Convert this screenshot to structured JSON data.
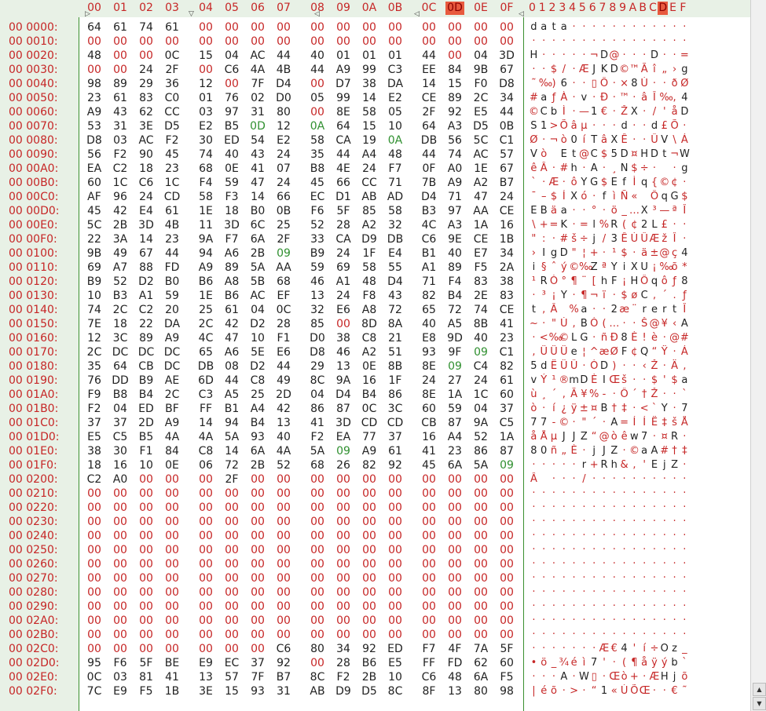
{
  "header": {
    "offsets": [
      "00",
      "01",
      "02",
      "03",
      "04",
      "05",
      "06",
      "07",
      "08",
      "09",
      "0A",
      "0B",
      "0C",
      "0D",
      "0E",
      "0F"
    ],
    "ascii_header": "0123456789ABCDEF",
    "selected_col": 13
  },
  "rows": [
    {
      "addr": "00 0000:",
      "bytes": [
        "64",
        "61",
        "74",
        "61",
        "00",
        "00",
        "00",
        "00",
        "00",
        "00",
        "00",
        "00",
        "00",
        "00",
        "00",
        "00"
      ],
      "ascii": "data············"
    },
    {
      "addr": "00 0010:",
      "bytes": [
        "00",
        "00",
        "00",
        "00",
        "00",
        "00",
        "00",
        "00",
        "00",
        "00",
        "00",
        "00",
        "00",
        "00",
        "00",
        "00"
      ],
      "ascii": "················"
    },
    {
      "addr": "00 0020:",
      "bytes": [
        "48",
        "00",
        "00",
        "0C",
        "15",
        "04",
        "AC",
        "44",
        "40",
        "01",
        "01",
        "01",
        "44",
        "00",
        "04",
        "3D"
      ],
      "ascii": "H·····¬D@···D··="
    },
    {
      "addr": "00 0030:",
      "bytes": [
        "00",
        "00",
        "24",
        "2F",
        "00",
        "C6",
        "4A",
        "4B",
        "44",
        "A9",
        "99",
        "C3",
        "EE",
        "84",
        "9B",
        "67"
      ],
      "ascii": "··$/·ÆJKD©™Ãî„›g"
    },
    {
      "addr": "00 0040:",
      "bytes": [
        "98",
        "89",
        "29",
        "36",
        "12",
        "00",
        "7F",
        "D4",
        "00",
        "D7",
        "38",
        "DA",
        "14",
        "15",
        "F0",
        "D8"
      ],
      "ascii": "˜‰)6··▯Ô·×8Ú··ðØ"
    },
    {
      "addr": "00 0050:",
      "bytes": [
        "23",
        "61",
        "83",
        "C0",
        "01",
        "76",
        "02",
        "D0",
        "05",
        "99",
        "14",
        "E2",
        "CE",
        "89",
        "2C",
        "34"
      ],
      "ascii": "#aƒÀ·v·Ð·™·âÎ‰,4"
    },
    {
      "addr": "00 0060:",
      "bytes": [
        "A9",
        "43",
        "62",
        "CC",
        "03",
        "97",
        "31",
        "80",
        "00",
        "8E",
        "58",
        "05",
        "2F",
        "92",
        "E5",
        "44"
      ],
      "ascii": "©CbÌ·—1€·ŽX·/'åD"
    },
    {
      "addr": "00 0070:",
      "bytes": [
        "53",
        "31",
        "3E",
        "D5",
        "E2",
        "B5",
        "0D",
        "12",
        "0A",
        "64",
        "15",
        "10",
        "64",
        "A3",
        "D5",
        "0B"
      ],
      "ascii": "S1>Õâµ···d··d£Õ·"
    },
    {
      "addr": "00 0080:",
      "bytes": [
        "D8",
        "03",
        "AC",
        "F2",
        "30",
        "ED",
        "54",
        "E2",
        "58",
        "CA",
        "19",
        "0A",
        "DB",
        "56",
        "5C",
        "C1"
      ],
      "ascii": "Ø·¬ò0íTâXÊ··ÛV\\Á"
    },
    {
      "addr": "00 0090:",
      "bytes": [
        "56",
        "F2",
        "90",
        "45",
        "74",
        "40",
        "43",
        "24",
        "35",
        "44",
        "A4",
        "48",
        "44",
        "74",
        "AC",
        "57"
      ],
      "ascii": "Vò Et@C$5D¤HDt¬W"
    },
    {
      "addr": "00 00A0:",
      "bytes": [
        "EA",
        "C2",
        "18",
        "23",
        "68",
        "0E",
        "41",
        "07",
        "B8",
        "4E",
        "24",
        "F7",
        "0F",
        "A0",
        "1E",
        "67"
      ],
      "ascii": "êÂ·#h·A·¸N$÷· ·g"
    },
    {
      "addr": "00 00B0:",
      "bytes": [
        "60",
        "1C",
        "C6",
        "1C",
        "F4",
        "59",
        "47",
        "24",
        "45",
        "66",
        "CC",
        "71",
        "7B",
        "A9",
        "A2",
        "B7"
      ],
      "ascii": "`·Æ·ôYG$EfÌq{©¢·"
    },
    {
      "addr": "00 00C0:",
      "bytes": [
        "AF",
        "96",
        "24",
        "CD",
        "58",
        "F3",
        "14",
        "66",
        "EC",
        "D1",
        "AB",
        "AD",
        "D4",
        "71",
        "47",
        "24"
      ],
      "ascii": "¯–$ÍXó·fìÑ«­ÔqG$"
    },
    {
      "addr": "00 00D0:",
      "bytes": [
        "45",
        "42",
        "E4",
        "61",
        "1E",
        "18",
        "B0",
        "0B",
        "F6",
        "5F",
        "85",
        "58",
        "B3",
        "97",
        "AA",
        "CE"
      ],
      "ascii": "EBäa··°·ö_…X³—ªÎ"
    },
    {
      "addr": "00 00E0:",
      "bytes": [
        "5C",
        "2B",
        "3D",
        "4B",
        "11",
        "3D",
        "6C",
        "25",
        "52",
        "28",
        "A2",
        "32",
        "4C",
        "A3",
        "1A",
        "16"
      ],
      "ascii": "\\+=K·=l%R(¢2L£··"
    },
    {
      "addr": "00 00F0:",
      "bytes": [
        "22",
        "3A",
        "14",
        "23",
        "9A",
        "F7",
        "6A",
        "2F",
        "33",
        "CA",
        "D9",
        "DB",
        "C6",
        "9E",
        "CE",
        "1B"
      ],
      "ascii": "\":·#š÷j/3ÊÙÛÆžÎ·"
    },
    {
      "addr": "00 0100:",
      "bytes": [
        "9B",
        "49",
        "67",
        "44",
        "94",
        "A6",
        "2B",
        "09",
        "B9",
        "24",
        "1F",
        "E4",
        "B1",
        "40",
        "E7",
        "34"
      ],
      "ascii": "›IgD\"¦+·¹$·ä±@ç4"
    },
    {
      "addr": "00 0110:",
      "bytes": [
        "69",
        "A7",
        "88",
        "FD",
        "A9",
        "89",
        "5A",
        "AA",
        "59",
        "69",
        "58",
        "55",
        "A1",
        "89",
        "F5",
        "2A"
      ],
      "ascii": "i§ˆý©‰ZªYiXU¡‰õ*"
    },
    {
      "addr": "00 0120:",
      "bytes": [
        "B9",
        "52",
        "D2",
        "B0",
        "B6",
        "A8",
        "5B",
        "68",
        "46",
        "A1",
        "48",
        "D4",
        "71",
        "F4",
        "83",
        "38"
      ],
      "ascii": "¹RÒ°¶¨[hF¡HÔqôƒ8"
    },
    {
      "addr": "00 0130:",
      "bytes": [
        "10",
        "B3",
        "A1",
        "59",
        "1E",
        "B6",
        "AC",
        "EF",
        "13",
        "24",
        "F8",
        "43",
        "82",
        "B4",
        "2E",
        "83"
      ],
      "ascii": "·³¡Y·¶¬ï·$øC‚´.ƒ"
    },
    {
      "addr": "00 0140:",
      "bytes": [
        "74",
        "2C",
        "C2",
        "20",
        "25",
        "61",
        "04",
        "0C",
        "32",
        "E6",
        "A8",
        "72",
        "65",
        "72",
        "74",
        "CE"
      ],
      "ascii": "t,Â %a··2æ¨rertÎ"
    },
    {
      "addr": "00 0150:",
      "bytes": [
        "7E",
        "18",
        "22",
        "DA",
        "2C",
        "42",
        "D2",
        "28",
        "85",
        "00",
        "8D",
        "8A",
        "40",
        "A5",
        "8B",
        "41"
      ],
      "ascii": "~·\"Ú,BÒ(…··Š@¥‹A"
    },
    {
      "addr": "00 0160:",
      "bytes": [
        "12",
        "3C",
        "89",
        "A9",
        "4C",
        "47",
        "10",
        "F1",
        "D0",
        "38",
        "C8",
        "21",
        "E8",
        "9D",
        "40",
        "23"
      ],
      "ascii": "·<‰©LG·ñÐ8È!è·@#"
    },
    {
      "addr": "00 0170:",
      "bytes": [
        "2C",
        "DC",
        "DC",
        "DC",
        "65",
        "A6",
        "5E",
        "E6",
        "D8",
        "46",
        "A2",
        "51",
        "93",
        "9F",
        "09",
        "C1"
      ],
      "ascii": ",ÜÜÜe¦^æØF¢Q“Ÿ·Á"
    },
    {
      "addr": "00 0180:",
      "bytes": [
        "35",
        "64",
        "CB",
        "DC",
        "DB",
        "08",
        "D2",
        "44",
        "29",
        "13",
        "0E",
        "8B",
        "8E",
        "09",
        "C4",
        "82"
      ],
      "ascii": "5dËÜÛ·ÒD)··‹Ž·Ä‚"
    },
    {
      "addr": "00 0190:",
      "bytes": [
        "76",
        "DD",
        "B9",
        "AE",
        "6D",
        "44",
        "C8",
        "49",
        "8C",
        "9A",
        "16",
        "1F",
        "24",
        "27",
        "24",
        "61"
      ],
      "ascii": "vÝ¹®mDÈIŒš··$'$a"
    },
    {
      "addr": "00 01A0:",
      "bytes": [
        "F9",
        "B8",
        "B4",
        "2C",
        "C3",
        "A5",
        "25",
        "2D",
        "04",
        "D4",
        "B4",
        "86",
        "8E",
        "1A",
        "1C",
        "60"
      ],
      "ascii": "ù¸´,Ã¥%-·Ô´†Ž··`"
    },
    {
      "addr": "00 01B0:",
      "bytes": [
        "F2",
        "04",
        "ED",
        "BF",
        "FF",
        "B1",
        "A4",
        "42",
        "86",
        "87",
        "0C",
        "3C",
        "60",
        "59",
        "04",
        "37"
      ],
      "ascii": "ò·í¿ÿ±¤B†‡·<`Y·7"
    },
    {
      "addr": "00 01C0:",
      "bytes": [
        "37",
        "37",
        "2D",
        "A9",
        "14",
        "94",
        "B4",
        "13",
        "41",
        "3D",
        "CD",
        "CD",
        "CB",
        "87",
        "9A",
        "C5"
      ],
      "ascii": "77-©·\"´·A=ÍÍË‡šÅ"
    },
    {
      "addr": "00 01D0:",
      "bytes": [
        "E5",
        "C5",
        "B5",
        "4A",
        "4A",
        "5A",
        "93",
        "40",
        "F2",
        "EA",
        "77",
        "37",
        "16",
        "A4",
        "52",
        "1A"
      ],
      "ascii": "åÅµJJZ“@òêw7·¤R·"
    },
    {
      "addr": "00 01E0:",
      "bytes": [
        "38",
        "30",
        "F1",
        "84",
        "C8",
        "14",
        "6A",
        "4A",
        "5A",
        "09",
        "A9",
        "61",
        "41",
        "23",
        "86",
        "87"
      ],
      "ascii": "80ñ„È·jJZ·©aA#†‡"
    },
    {
      "addr": "00 01F0:",
      "bytes": [
        "18",
        "16",
        "10",
        "0E",
        "06",
        "72",
        "2B",
        "52",
        "68",
        "26",
        "82",
        "92",
        "45",
        "6A",
        "5A",
        "09"
      ],
      "ascii": "·····r+Rh&‚'EjZ·"
    },
    {
      "addr": "00 0200:",
      "bytes": [
        "C2",
        "A0",
        "00",
        "00",
        "00",
        "2F",
        "00",
        "00",
        "00",
        "00",
        "00",
        "00",
        "00",
        "00",
        "00",
        "00"
      ],
      "ascii": "Â ···/··········"
    },
    {
      "addr": "00 0210:",
      "bytes": [
        "00",
        "00",
        "00",
        "00",
        "00",
        "00",
        "00",
        "00",
        "00",
        "00",
        "00",
        "00",
        "00",
        "00",
        "00",
        "00"
      ],
      "ascii": "················"
    },
    {
      "addr": "00 0220:",
      "bytes": [
        "00",
        "00",
        "00",
        "00",
        "00",
        "00",
        "00",
        "00",
        "00",
        "00",
        "00",
        "00",
        "00",
        "00",
        "00",
        "00"
      ],
      "ascii": "················"
    },
    {
      "addr": "00 0230:",
      "bytes": [
        "00",
        "00",
        "00",
        "00",
        "00",
        "00",
        "00",
        "00",
        "00",
        "00",
        "00",
        "00",
        "00",
        "00",
        "00",
        "00"
      ],
      "ascii": "················"
    },
    {
      "addr": "00 0240:",
      "bytes": [
        "00",
        "00",
        "00",
        "00",
        "00",
        "00",
        "00",
        "00",
        "00",
        "00",
        "00",
        "00",
        "00",
        "00",
        "00",
        "00"
      ],
      "ascii": "················"
    },
    {
      "addr": "00 0250:",
      "bytes": [
        "00",
        "00",
        "00",
        "00",
        "00",
        "00",
        "00",
        "00",
        "00",
        "00",
        "00",
        "00",
        "00",
        "00",
        "00",
        "00"
      ],
      "ascii": "················"
    },
    {
      "addr": "00 0260:",
      "bytes": [
        "00",
        "00",
        "00",
        "00",
        "00",
        "00",
        "00",
        "00",
        "00",
        "00",
        "00",
        "00",
        "00",
        "00",
        "00",
        "00"
      ],
      "ascii": "················"
    },
    {
      "addr": "00 0270:",
      "bytes": [
        "00",
        "00",
        "00",
        "00",
        "00",
        "00",
        "00",
        "00",
        "00",
        "00",
        "00",
        "00",
        "00",
        "00",
        "00",
        "00"
      ],
      "ascii": "················"
    },
    {
      "addr": "00 0280:",
      "bytes": [
        "00",
        "00",
        "00",
        "00",
        "00",
        "00",
        "00",
        "00",
        "00",
        "00",
        "00",
        "00",
        "00",
        "00",
        "00",
        "00"
      ],
      "ascii": "················"
    },
    {
      "addr": "00 0290:",
      "bytes": [
        "00",
        "00",
        "00",
        "00",
        "00",
        "00",
        "00",
        "00",
        "00",
        "00",
        "00",
        "00",
        "00",
        "00",
        "00",
        "00"
      ],
      "ascii": "················"
    },
    {
      "addr": "00 02A0:",
      "bytes": [
        "00",
        "00",
        "00",
        "00",
        "00",
        "00",
        "00",
        "00",
        "00",
        "00",
        "00",
        "00",
        "00",
        "00",
        "00",
        "00"
      ],
      "ascii": "················"
    },
    {
      "addr": "00 02B0:",
      "bytes": [
        "00",
        "00",
        "00",
        "00",
        "00",
        "00",
        "00",
        "00",
        "00",
        "00",
        "00",
        "00",
        "00",
        "00",
        "00",
        "00"
      ],
      "ascii": "················"
    },
    {
      "addr": "00 02C0:",
      "bytes": [
        "00",
        "00",
        "00",
        "00",
        "00",
        "00",
        "00",
        "C6",
        "80",
        "34",
        "92",
        "ED",
        "F7",
        "4F",
        "7A",
        "5F"
      ],
      "ascii": "·······Æ€4'í÷Oz_"
    },
    {
      "addr": "00 02D0:",
      "bytes": [
        "95",
        "F6",
        "5F",
        "BE",
        "E9",
        "EC",
        "37",
        "92",
        "00",
        "28",
        "B6",
        "E5",
        "FF",
        "FD",
        "62",
        "60"
      ],
      "ascii": "•ö_¾éì7'·(¶åÿýb`"
    },
    {
      "addr": "00 02E0:",
      "bytes": [
        "0C",
        "03",
        "81",
        "41",
        "13",
        "57",
        "7F",
        "B7",
        "8C",
        "F2",
        "2B",
        "10",
        "C6",
        "48",
        "6A",
        "F5"
      ],
      "ascii": "···A·W▯·Œò+·ÆHjõ"
    },
    {
      "addr": "00 02F0:",
      "bytes": [
        "7C",
        "E9",
        "F5",
        "1B",
        "3E",
        "15",
        "93",
        "31",
        "AB",
        "D9",
        "D5",
        "8C",
        "8F",
        "13",
        "80",
        "98"
      ],
      "ascii": "|éõ·>·“1«ÙÕŒ··€˜"
    }
  ],
  "colors": {
    "red": "#c62626",
    "dark": "#222222",
    "green": "#2f8f2f",
    "selected_header": "#e85a3f"
  }
}
